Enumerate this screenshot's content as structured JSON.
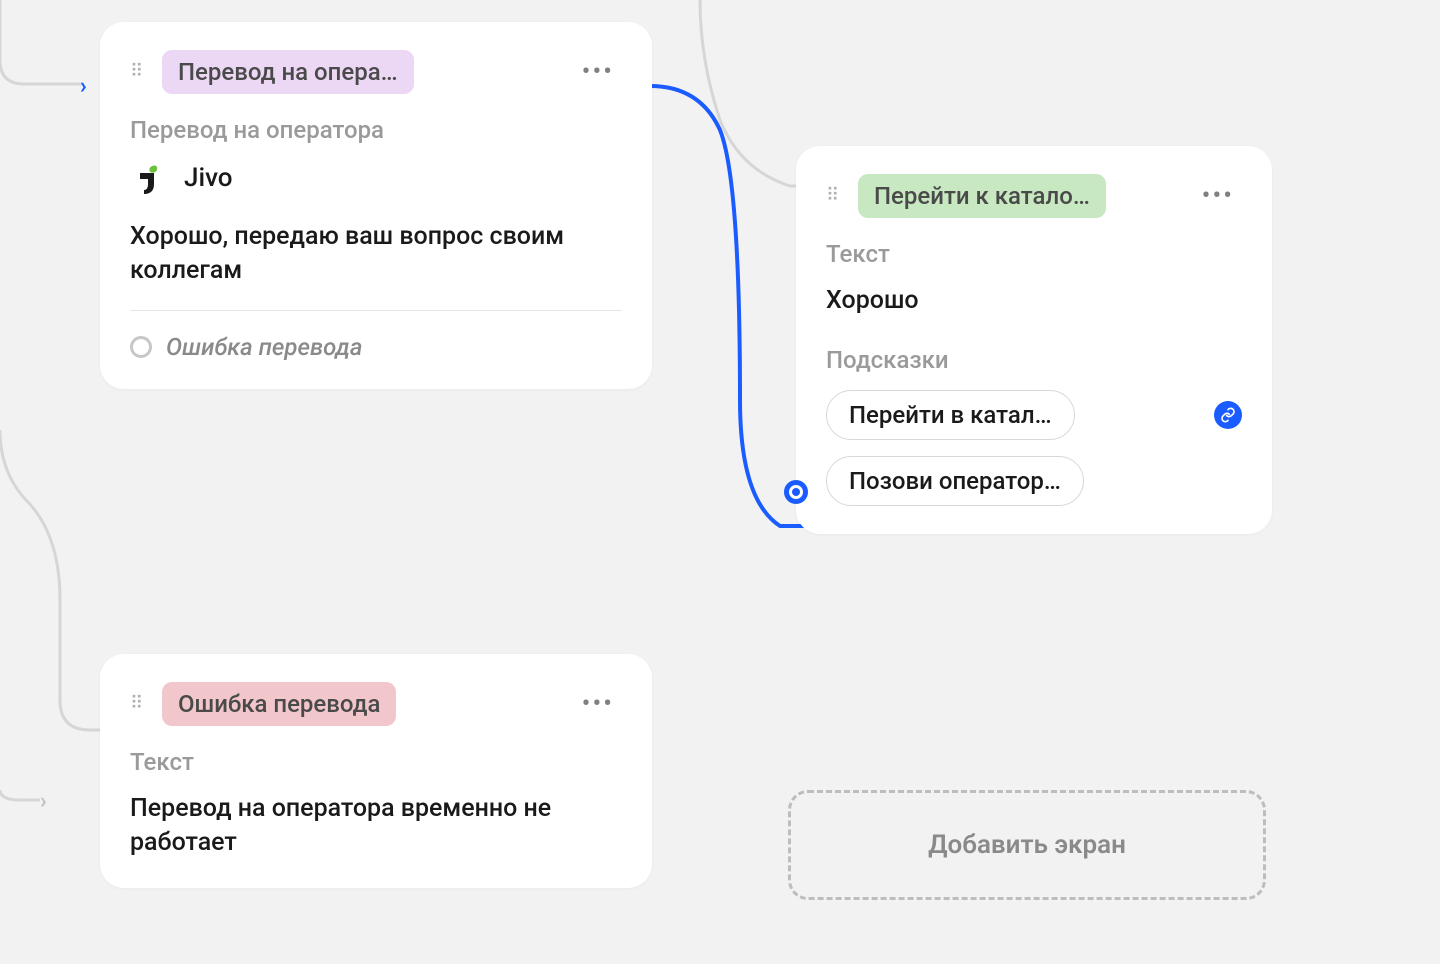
{
  "card1": {
    "tag": "Перевод на опера…",
    "section_label": "Перевод на оператора",
    "integration_name": "Jivo",
    "body": "Хорошо, передаю ваш вопрос своим коллегам",
    "error_label": "Ошибка перевода"
  },
  "card2": {
    "tag": "Ошибка перевода",
    "section_label": "Текст",
    "body": "Перевод на оператора временно не работает"
  },
  "card3": {
    "tag": "Перейти к катало…",
    "section_label_text": "Текст",
    "body_text": "Хорошо",
    "section_label_hints": "Подсказки",
    "chip1": "Перейти в катал…",
    "chip2": "Позови оператор…"
  },
  "add_screen": "Добавить экран"
}
